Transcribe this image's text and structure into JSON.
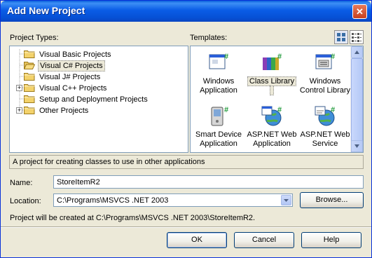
{
  "window": {
    "title": "Add New Project",
    "close_glyph": "✕"
  },
  "project_types": {
    "label": "Project Types:",
    "items": [
      {
        "label": "Visual Basic Projects",
        "expander": "",
        "icon": "folder-icon"
      },
      {
        "label": "Visual C# Projects",
        "expander": "",
        "icon": "open-folder-icon",
        "selected": true
      },
      {
        "label": "Visual J# Projects",
        "expander": "",
        "icon": "folder-icon"
      },
      {
        "label": "Visual C++ Projects",
        "expander": "+",
        "icon": "folder-icon"
      },
      {
        "label": "Setup and Deployment Projects",
        "expander": "",
        "icon": "folder-icon"
      },
      {
        "label": "Other Projects",
        "expander": "+",
        "icon": "folder-icon"
      }
    ]
  },
  "templates": {
    "label": "Templates:",
    "items": [
      {
        "line1": "Windows",
        "line2": "Application",
        "icon": "windows-app-icon"
      },
      {
        "line1": "Class Library",
        "line2": "",
        "icon": "class-library-icon",
        "selected": true
      },
      {
        "line1": "Windows",
        "line2": "Control Library",
        "icon": "control-library-icon"
      },
      {
        "line1": "Smart Device",
        "line2": "Application",
        "icon": "smart-device-icon"
      },
      {
        "line1": "ASP.NET Web",
        "line2": "Application",
        "icon": "web-application-icon"
      },
      {
        "line1": "ASP.NET Web",
        "line2": "Service",
        "icon": "web-service-icon"
      }
    ],
    "view_modes": [
      "large-icons-view-icon",
      "small-icons-view-icon"
    ]
  },
  "description": "A project for creating classes to use in other applications",
  "form": {
    "name_label": "Name:",
    "name_value": "StoreItemR2",
    "location_label": "Location:",
    "location_value": "C:\\Programs\\MSVCS .NET 2003",
    "browse_label": "Browse...",
    "created_at_text": "Project will be created at C:\\Programs\\MSVCS .NET 2003\\StoreItemR2."
  },
  "buttons": {
    "ok": "OK",
    "cancel": "Cancel",
    "help": "Help"
  },
  "colors": {
    "title_bar": "#0a5ce6",
    "dialog_bg": "#ece9d8",
    "border": "#7f9db9",
    "folder": "#f3d26b",
    "csharp_green": "#1f9a3a"
  }
}
